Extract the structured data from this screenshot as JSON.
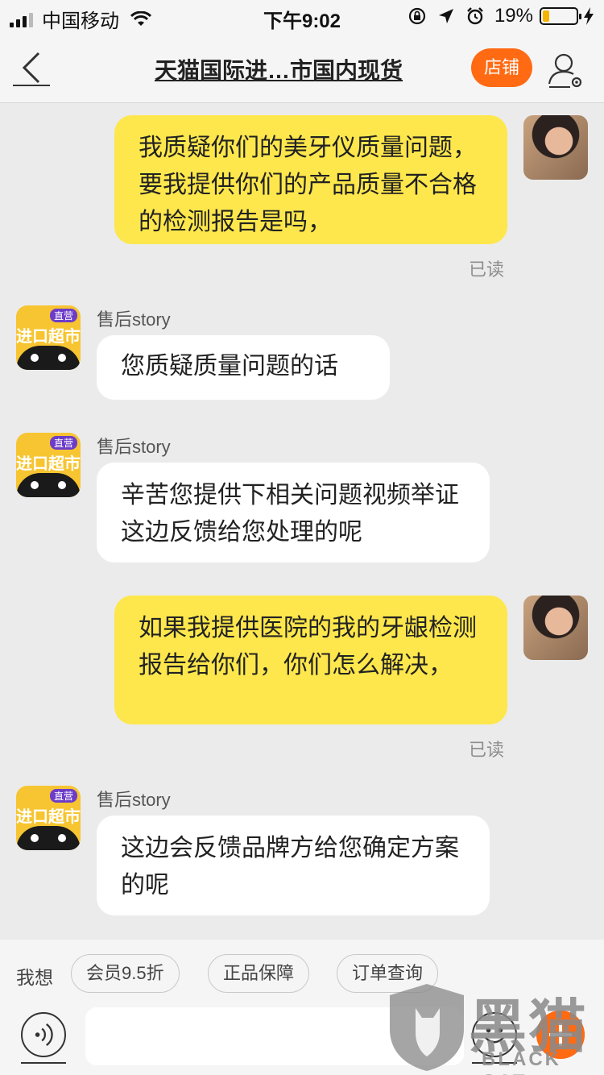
{
  "status_bar": {
    "carrier": "中国移动",
    "time": "下午9:02",
    "battery_percent": "19%",
    "battery_level": 0.19,
    "icons": [
      "signal-icon",
      "wifi-icon",
      "orientation-lock-icon",
      "location-icon",
      "alarm-icon",
      "battery-icon",
      "charging-icon"
    ]
  },
  "nav": {
    "title": "天猫国际进…市国内现货",
    "shop_label": "店铺",
    "icons": [
      "back-arrow-icon",
      "profile-settings-icon"
    ]
  },
  "messages": [
    {
      "from": "me",
      "text": "我质疑你们的美牙仪质量问题，要我提供你们的产品质量不合格的检测报告是吗，",
      "status": "已读"
    },
    {
      "from": "shop",
      "sender": "售后story",
      "text": "您质疑质量问题的话"
    },
    {
      "from": "shop",
      "sender": "售后story",
      "text": "辛苦您提供下相关问题视频举证  这边反馈给您处理的呢"
    },
    {
      "from": "me",
      "text": "如果我提供医院的我的牙龈检测报告给你们，你们怎么解决，",
      "status": "已读"
    },
    {
      "from": "shop",
      "sender": "售后story",
      "text": "这边会反馈品牌方给您确定方案的呢"
    }
  ],
  "shop_avatar": {
    "badge": "直营",
    "brand": "进口超市"
  },
  "quick_bar": {
    "label": "我想",
    "chips": [
      "会员9.5折",
      "正品保障",
      "订单查询"
    ]
  },
  "input": {
    "placeholder": ""
  },
  "watermark": {
    "text": "黑猫",
    "sub": "BLACK CAT"
  },
  "colors": {
    "accent": "#ff6a13",
    "my_bubble": "#fde74c",
    "their_bubble": "#ffffff",
    "background": "#ebebeb"
  }
}
